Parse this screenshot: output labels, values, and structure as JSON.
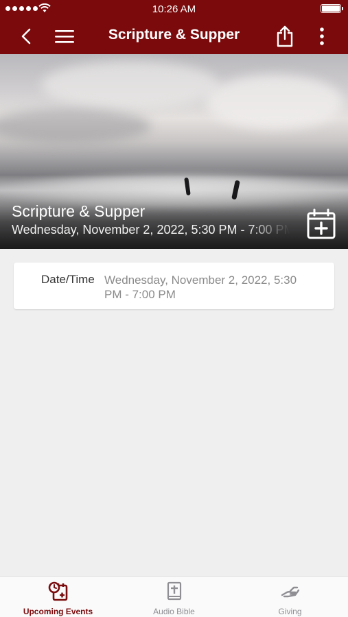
{
  "status_bar": {
    "time": "10:26 AM"
  },
  "nav": {
    "title": "Scripture & Supper"
  },
  "hero": {
    "title": "Scripture & Supper",
    "subtitle": "Wednesday, November 2, 2022, 5:30 PM - 7:00 PM"
  },
  "details": {
    "label": "Date/Time",
    "value": "Wednesday, November 2, 2022, 5:30 PM - 7:00 PM"
  },
  "tabs": [
    {
      "label": "Upcoming Events",
      "icon": "calendar-clock-icon",
      "active": true
    },
    {
      "label": "Audio Bible",
      "icon": "bible-icon",
      "active": false
    },
    {
      "label": "Giving",
      "icon": "giving-hand-icon",
      "active": false
    }
  ],
  "colors": {
    "brand": "#7a0a0c",
    "tab_inactive": "#8e8e93",
    "background": "#efefef"
  }
}
